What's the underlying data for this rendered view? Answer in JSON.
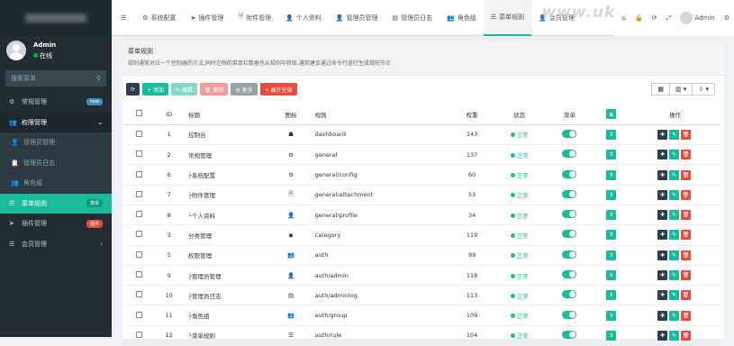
{
  "sidebar": {
    "user": {
      "name": "Admin",
      "status": "在线"
    },
    "search_placeholder": "搜索菜单",
    "items": [
      {
        "icon": "⚙",
        "label": "常规管理",
        "badge": "new",
        "badge_type": "new",
        "state": "normal"
      },
      {
        "icon": "👥",
        "label": "权限管理",
        "badge": "⌄",
        "badge_type": "",
        "state": "open"
      },
      {
        "icon": "👤",
        "label": "管理员管理",
        "badge": "",
        "badge_type": "",
        "state": "sub"
      },
      {
        "icon": "📋",
        "label": "管理员日志",
        "badge": "",
        "badge_type": "",
        "state": "sub"
      },
      {
        "icon": "👥",
        "label": "角色组",
        "badge": "",
        "badge_type": "",
        "state": "sub"
      },
      {
        "icon": "☰",
        "label": "菜单规则",
        "badge": "菜单",
        "badge_type": "green",
        "state": "active"
      },
      {
        "icon": "➤",
        "label": "插件管理",
        "badge": "插件",
        "badge_type": "red",
        "state": "normal"
      },
      {
        "icon": "☰",
        "label": "会员管理",
        "badge": "‹",
        "badge_type": "",
        "state": "normal"
      }
    ]
  },
  "topbar": {
    "menu_icon": "☰",
    "tabs": [
      {
        "icon": "⚙",
        "label": "系统配置"
      },
      {
        "icon": "➤",
        "label": "插件管理"
      },
      {
        "icon": "🗎",
        "label": "附件管理"
      },
      {
        "icon": "👤",
        "label": "个人资料"
      },
      {
        "icon": "👤",
        "label": "管理员管理"
      },
      {
        "icon": "▤",
        "label": "管理员日志"
      },
      {
        "icon": "👥",
        "label": "角色组"
      },
      {
        "icon": "☰",
        "label": "菜单规则"
      },
      {
        "icon": "👤",
        "label": "会员管理"
      }
    ],
    "watermark": "www.ukewu.com",
    "right": {
      "home": "⌂",
      "lock": "🔒",
      "refresh": "⟳",
      "fullscreen": "⤢",
      "user": "Admin",
      "settings": "⚙"
    }
  },
  "panel": {
    "title": "菜单规则",
    "desc": "规则通常对应一个控制器的方法,同时左侧的菜单栏数据也从规则中获取,通常建议通过命令行进行生成规则节点",
    "buttons": [
      "⟳",
      "+ 添加",
      "✎ 编辑",
      "🗑 删除",
      "⚙ 更多",
      "+ 展开全部"
    ],
    "tools": [
      "▦",
      "▥ ▾",
      "⇩ ▾"
    ],
    "columns": [
      "",
      "ID",
      "标题",
      "图标",
      "规则",
      "权重",
      "状态",
      "菜单",
      "▲",
      "操作"
    ],
    "rows": [
      {
        "id": "1",
        "title": "控制台",
        "icon": "☗",
        "rule": "dashboard",
        "weigh": "143",
        "status": "正常"
      },
      {
        "id": "2",
        "title": "常规管理",
        "icon": "⚙",
        "rule": "general",
        "weigh": "137",
        "status": "正常"
      },
      {
        "id": "6",
        "title": "├系统配置",
        "icon": "⚙",
        "rule": "general/config",
        "weigh": "60",
        "status": "正常"
      },
      {
        "id": "7",
        "title": "├附件管理",
        "icon": "🗎",
        "rule": "general/attachment",
        "weigh": "53",
        "status": "正常"
      },
      {
        "id": "8",
        "title": "└个人资料",
        "icon": "👤",
        "rule": "general/profile",
        "weigh": "34",
        "status": "正常"
      },
      {
        "id": "3",
        "title": "分类管理",
        "icon": "◆",
        "rule": "category",
        "weigh": "119",
        "status": "正常"
      },
      {
        "id": "5",
        "title": "权限管理",
        "icon": "👥",
        "rule": "auth",
        "weigh": "99",
        "status": "正常"
      },
      {
        "id": "9",
        "title": "├管理员管理",
        "icon": "👤",
        "rule": "auth/admin",
        "weigh": "118",
        "status": "正常"
      },
      {
        "id": "10",
        "title": "├管理员日志",
        "icon": "▤",
        "rule": "auth/adminlog",
        "weigh": "113",
        "status": "正常"
      },
      {
        "id": "11",
        "title": "├角色组",
        "icon": "👥",
        "rule": "auth/group",
        "weigh": "109",
        "status": "正常"
      },
      {
        "id": "12",
        "title": "└菜单规则",
        "icon": "☰",
        "rule": "auth/rule",
        "weigh": "104",
        "status": "正常"
      }
    ]
  }
}
